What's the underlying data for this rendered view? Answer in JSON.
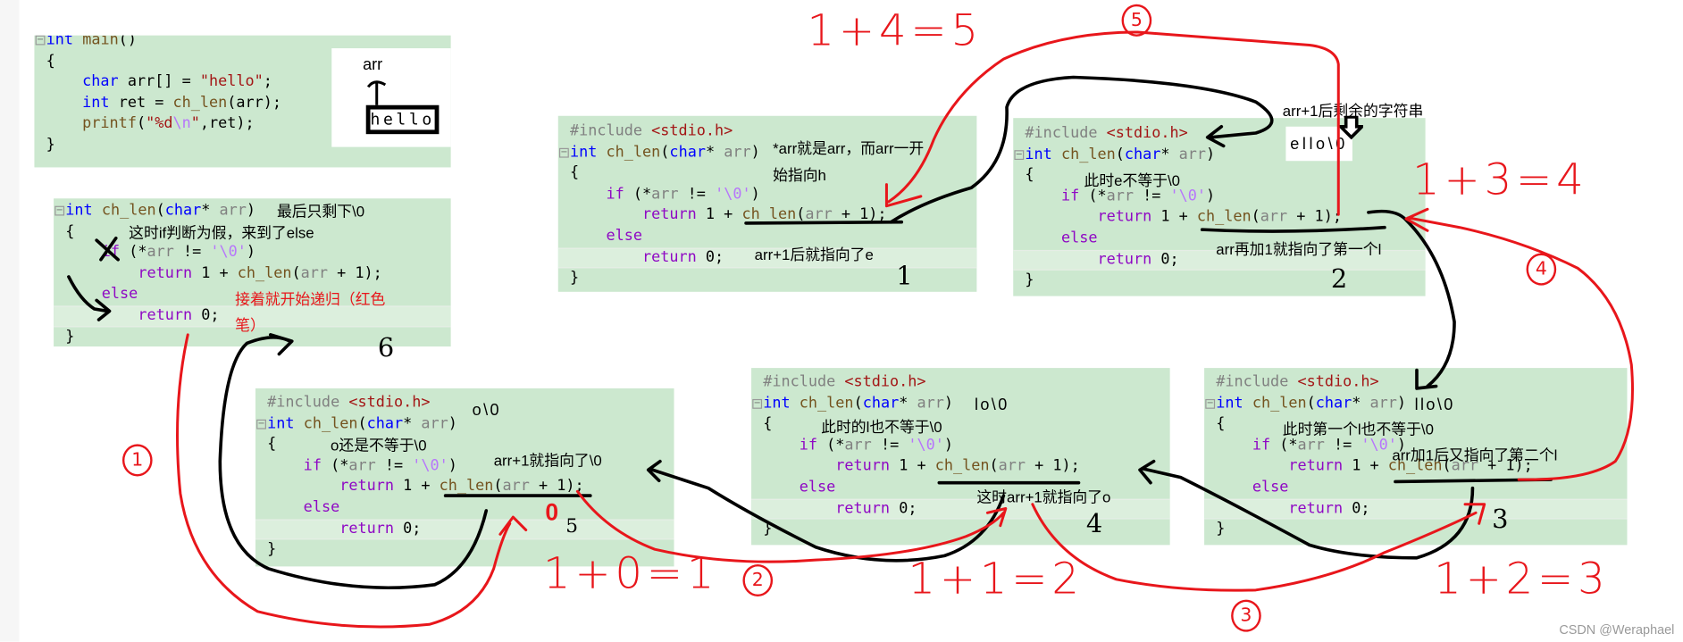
{
  "code": {
    "main": [
      [
        [
          "kw",
          "int"
        ],
        [
          "tx",
          " "
        ],
        [
          "fn",
          "main"
        ],
        [
          "tx",
          "()"
        ]
      ],
      [
        [
          "tx",
          "{"
        ]
      ],
      [
        [
          "kw",
          "char"
        ],
        [
          "tx",
          " arr[] = "
        ],
        [
          "str",
          "\"hello\""
        ],
        [
          "tx",
          ";"
        ]
      ],
      [
        [
          "kw",
          "int"
        ],
        [
          "tx",
          " ret = "
        ],
        [
          "fn",
          "ch_len"
        ],
        [
          "tx",
          "(arr);"
        ]
      ],
      [
        [
          "fn",
          "printf"
        ],
        [
          "tx",
          "("
        ],
        [
          "str",
          "\"%d"
        ],
        [
          "esc",
          "\\n"
        ],
        [
          "str",
          "\""
        ],
        [
          "tx",
          ",ret);"
        ]
      ],
      [
        [
          "tx",
          "}"
        ]
      ]
    ],
    "ch_len": [
      [
        [
          "pp",
          "#include "
        ],
        [
          "str",
          "<stdio.h>"
        ]
      ],
      [
        [
          "kw",
          "int"
        ],
        [
          "tx",
          " "
        ],
        [
          "fn",
          "ch_len"
        ],
        [
          "tx",
          "("
        ],
        [
          "kw",
          "char"
        ],
        [
          "tx",
          "* "
        ],
        [
          "pm",
          "arr"
        ],
        [
          "tx",
          ")"
        ]
      ],
      [
        [
          "tx",
          "{"
        ]
      ],
      [
        [
          "ct",
          "if"
        ],
        [
          "tx",
          " (*"
        ],
        [
          "pm",
          "arr"
        ],
        [
          "tx",
          " != "
        ],
        [
          "esc",
          "'\\0'"
        ],
        [
          "tx",
          ")"
        ]
      ],
      [
        [
          "ct",
          "return"
        ],
        [
          "tx",
          " 1 + "
        ],
        [
          "fn",
          "ch_len"
        ],
        [
          "tx",
          "("
        ],
        [
          "pm",
          "arr"
        ],
        [
          "tx",
          " + 1);"
        ]
      ],
      [
        [
          "ct",
          "else"
        ]
      ],
      [
        [
          "ct",
          "return"
        ],
        [
          "tx",
          " 0;"
        ]
      ],
      [
        [
          "tx",
          "}"
        ]
      ]
    ]
  },
  "main_panel": {
    "pointer_label": "arr",
    "string_box": "hello"
  },
  "panel1": {
    "note_a": "*arr就是arr，而arr一开",
    "note_b": "始指向h",
    "note_c": "arr+1后就指向了e",
    "step": "1"
  },
  "panel2": {
    "note_top": "arr+1后剩余的字符串",
    "remaining": "ello\\0",
    "note_a": "此时e不等于\\0",
    "note_b": "arr再加1就指向了第一个l",
    "step": "2"
  },
  "panel3": {
    "remaining": "llo\\0",
    "note_a": "此时第一个l也不等于\\0",
    "note_b": "arr加1后又指向了第二个l",
    "step": "3"
  },
  "panel4": {
    "remaining": "lo\\0",
    "note_a": "此时的l也不等于\\0",
    "note_b": "这时arr+1就指向了o",
    "step": "4"
  },
  "panel5": {
    "remaining": "o\\0",
    "note_a": "o还是不等于\\0",
    "note_b": "arr+1就指向了\\0",
    "return_value": "0",
    "step": "5"
  },
  "panel6": {
    "note_a": "最后只剩下\\0",
    "note_b": "这时if判断为假，来到了else",
    "note_c": "接着就开始递归（红色",
    "note_d": "笔）",
    "step": "6"
  },
  "returns": {
    "r5": "1+4=5",
    "r4": "1+3=4",
    "r3": "1+2=3",
    "r2": "1+1=2",
    "r1": "1+0=1"
  },
  "circled_steps": [
    "1",
    "2",
    "3",
    "4",
    "5"
  ],
  "watermark": "CSDN @Weraphael",
  "colors": {
    "panel_bg": "#cce8cf",
    "ink_red": "#e8161b",
    "ink_black": "#000000",
    "keyword": "#0000ff",
    "control": "#8f08c4",
    "string": "#a31515"
  }
}
